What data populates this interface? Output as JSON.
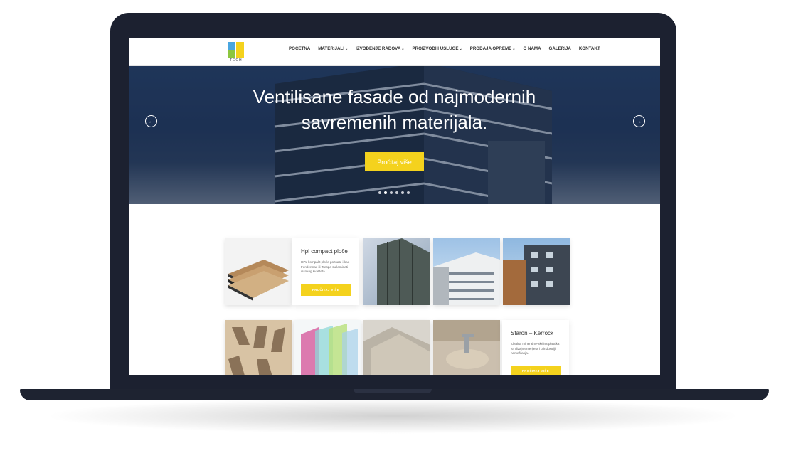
{
  "brand": {
    "logo_text": "TECH",
    "colors": {
      "blue": "#4aa6e0",
      "yellow": "#f4d21d",
      "green": "#8cc63f",
      "dark": "#3a3f4a"
    }
  },
  "nav": {
    "items": [
      {
        "label": "POČETNA",
        "dropdown": false
      },
      {
        "label": "MATERIJALI",
        "dropdown": true
      },
      {
        "label": "IZVOĐENJE RADOVA",
        "dropdown": true
      },
      {
        "label": "PROIZVODI I USLUGE",
        "dropdown": true
      },
      {
        "label": "PRODAJA OPREME",
        "dropdown": true
      },
      {
        "label": "O NAMA",
        "dropdown": false
      },
      {
        "label": "GALERIJA",
        "dropdown": false
      },
      {
        "label": "KONTAKT",
        "dropdown": false
      }
    ],
    "caret": "⌄"
  },
  "hero": {
    "title": "Ventilisane fasade od najmodernih\nsavremenih materijala.",
    "button": "Pročitaj više",
    "prev_icon": "arrow-left-icon",
    "next_icon": "arrow-right-icon",
    "slides_count": 6,
    "active_slide": 1
  },
  "products": {
    "card1": {
      "title": "Hpl compact ploče",
      "desc": "HPL kompakt ploče poznate i kao Fundermax ili Trespa su laminati visokog kvaliteta.",
      "button": "PROČITAJ VIŠE"
    },
    "card2": {
      "title": "Staron – Kerrock",
      "desc": "Idealna mineralno-akrilna plastika za dizajn enterijera i u industriji nameštanja.",
      "button": "PROČITAJ VIŠE"
    }
  },
  "accent_colors": {
    "button": "#f4d21d",
    "hero": "#243d63"
  }
}
